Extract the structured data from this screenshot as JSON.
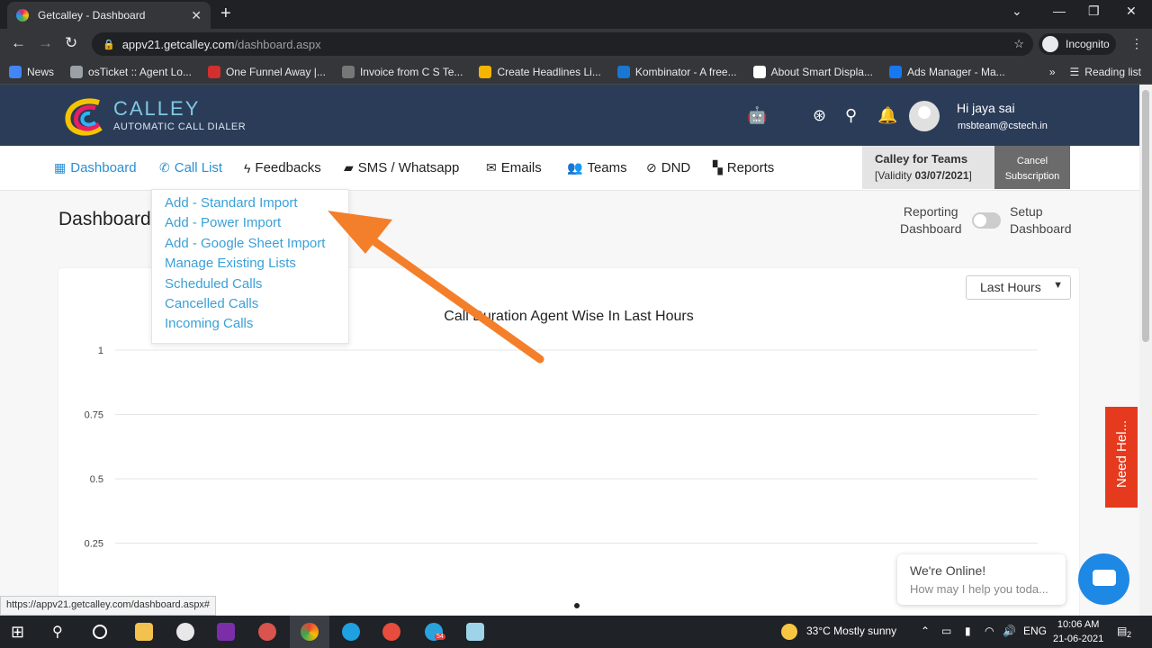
{
  "browser": {
    "tab_title": "Getcalley - Dashboard",
    "url_host": "appv21.getcalley.com",
    "url_path": "/dashboard.aspx",
    "incognito_label": "Incognito",
    "bookmarks": [
      {
        "label": "News",
        "color": "#4285f4"
      },
      {
        "label": "osTicket :: Agent Lo...",
        "color": "#9aa0a6"
      },
      {
        "label": "One Funnel Away |...",
        "color": "#d32f2f"
      },
      {
        "label": "Invoice from C S Te...",
        "color": "#777777"
      },
      {
        "label": "Create Headlines Li...",
        "color": "#f4b400"
      },
      {
        "label": "Kombinator - A free...",
        "color": "#1976d2"
      },
      {
        "label": "About Smart Displa...",
        "color": "#ffffff"
      },
      {
        "label": "Ads Manager - Ma...",
        "color": "#1877f2"
      }
    ],
    "more_label": "»",
    "reading_list": "Reading list",
    "status_url": "https://appv21.getcalley.com/dashboard.aspx#"
  },
  "header": {
    "brand": "CALLEY",
    "tagline": "AUTOMATIC CALL DIALER",
    "greeting": "Hi jaya sai",
    "email": "msbteam@cstech.in",
    "icons": [
      "android-icon",
      "apple-icon",
      "support-icon",
      "search-icon",
      "bell-icon"
    ]
  },
  "nav": {
    "items": [
      {
        "label": "Dashboard",
        "icon": "▦"
      },
      {
        "label": "Call List",
        "icon": "✆"
      },
      {
        "label": "Feedbacks",
        "icon": "ϟ"
      },
      {
        "label": "SMS / Whatsapp",
        "icon": "▰"
      },
      {
        "label": "Emails",
        "icon": "✉"
      },
      {
        "label": "Teams",
        "icon": "👥"
      },
      {
        "label": "DND",
        "icon": "⊘"
      },
      {
        "label": "Reports",
        "icon": "▚"
      }
    ],
    "plan_title": "Calley for Teams",
    "plan_validity_prefix": "[Validity ",
    "plan_validity_date": "03/07/2021",
    "plan_validity_suffix": "]",
    "cancel_line1": "Cancel",
    "cancel_line2": "Subscription"
  },
  "dropdown": {
    "items": [
      "Add - Standard Import",
      "Add - Power Import",
      "Add - Google Sheet Import",
      "Manage Existing Lists",
      "Scheduled Calls",
      "Cancelled Calls",
      "Incoming Calls"
    ]
  },
  "page": {
    "title": "Dashboard",
    "toggle_left_1": "Reporting",
    "toggle_left_2": "Dashboard",
    "toggle_right_1": "Setup",
    "toggle_right_2": "Dashboard",
    "period_select": "Last Hours"
  },
  "chart_data": {
    "type": "bar",
    "title": "Call Duration Agent Wise In Last Hours",
    "xlabel": "",
    "ylabel": "",
    "ylim": [
      0,
      1
    ],
    "y_ticks": [
      "1",
      "0.75",
      "0.5",
      "0.25"
    ],
    "categories": [],
    "values": [],
    "grid": true
  },
  "widgets": {
    "need_help": "Need Hel...",
    "chat_line1": "We're Online!",
    "chat_line2": "How may I help you toda..."
  },
  "taskbar": {
    "weather": "33°C  Mostly sunny",
    "lang": "ENG",
    "time": "10:06 AM",
    "date": "21-06-2021",
    "notif_count": "2",
    "telegram_badge": "54"
  }
}
